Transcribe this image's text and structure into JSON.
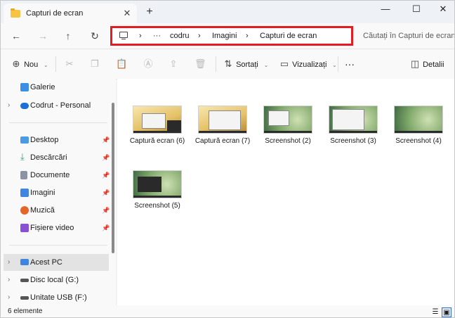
{
  "window": {
    "tab_title": "Capturi de ecran",
    "tab_icon": "folder-icon",
    "controls": {
      "minimize": "—",
      "maximize": "☐",
      "close": "✕"
    }
  },
  "nav": {
    "back": "←",
    "forward": "→",
    "up": "↑",
    "refresh": "↻",
    "breadcrumb": {
      "sep": "›",
      "ellipsis": "···",
      "items": [
        "codru",
        "Imagini",
        "Capturi de ecran"
      ]
    },
    "search_placeholder": "Căutați în Capturi de ecran"
  },
  "toolbar": {
    "new_label": "Nou",
    "sort_label": "Sortați",
    "view_label": "Vizualizați",
    "more": "···",
    "details_label": "Detalii"
  },
  "sidebar": {
    "items": [
      {
        "label": "Galerie",
        "icon": "gallery-icon",
        "color": "#3a8ee6"
      },
      {
        "label": "Codrut - Personal",
        "icon": "cloud-icon",
        "color": "#1b6fd8"
      },
      {
        "label": "Desktop",
        "icon": "desktop-icon",
        "color": "#4a9be3"
      },
      {
        "label": "Descărcări",
        "icon": "download-icon",
        "color": "#2fa36b"
      },
      {
        "label": "Documente",
        "icon": "documents-icon",
        "color": "#8a94a6"
      },
      {
        "label": "Imagini",
        "icon": "pictures-icon",
        "color": "#3e86e0"
      },
      {
        "label": "Muzică",
        "icon": "music-icon",
        "color": "#e5662b"
      },
      {
        "label": "Fișiere video",
        "icon": "videos-icon",
        "color": "#8b4fd6"
      },
      {
        "label": "Acest PC",
        "icon": "pc-icon",
        "color": "#3e86e0"
      },
      {
        "label": "Disc local (G:)",
        "icon": "drive-icon",
        "color": "#555555"
      },
      {
        "label": "Unitate USB (F:)",
        "icon": "usb-drive-icon",
        "color": "#555555"
      }
    ]
  },
  "files": [
    {
      "name": "Captură ecran (6)",
      "style": "yellow"
    },
    {
      "name": "Captură ecran (7)",
      "style": "yellow"
    },
    {
      "name": "Screenshot (2)",
      "style": "green"
    },
    {
      "name": "Screenshot (3)",
      "style": "green"
    },
    {
      "name": "Screenshot (4)",
      "style": "green"
    },
    {
      "name": "Screenshot (5)",
      "style": "green"
    }
  ],
  "status": {
    "count_text": "6 elemente"
  },
  "colors": {
    "highlight_border": "#e31b23",
    "selected_row": "#e3e3e3",
    "accent": "#2f6fd0"
  }
}
